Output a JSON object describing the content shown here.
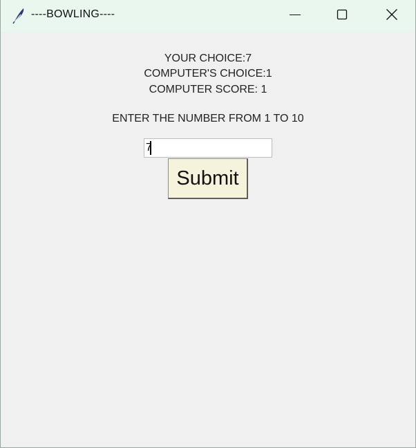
{
  "window": {
    "title": "----BOWLING----",
    "app_icon": "feather-icon",
    "controls": {
      "minimize_icon": "minimize-icon",
      "maximize_icon": "maximize-icon",
      "close_icon": "close-icon"
    }
  },
  "game": {
    "your_choice": "YOUR CHOICE:7",
    "computer_choice": "COMPUTER'S CHOICE:1",
    "computer_score": "COMPUTER SCORE: 1",
    "prompt": "ENTER THE NUMBER FROM 1 TO 10"
  },
  "input": {
    "value": "7"
  },
  "submit": {
    "label": "Submit"
  },
  "colors": {
    "titlebar": "#e9f7ee",
    "background": "#f0f0f0",
    "button": "#f6f3dc"
  }
}
